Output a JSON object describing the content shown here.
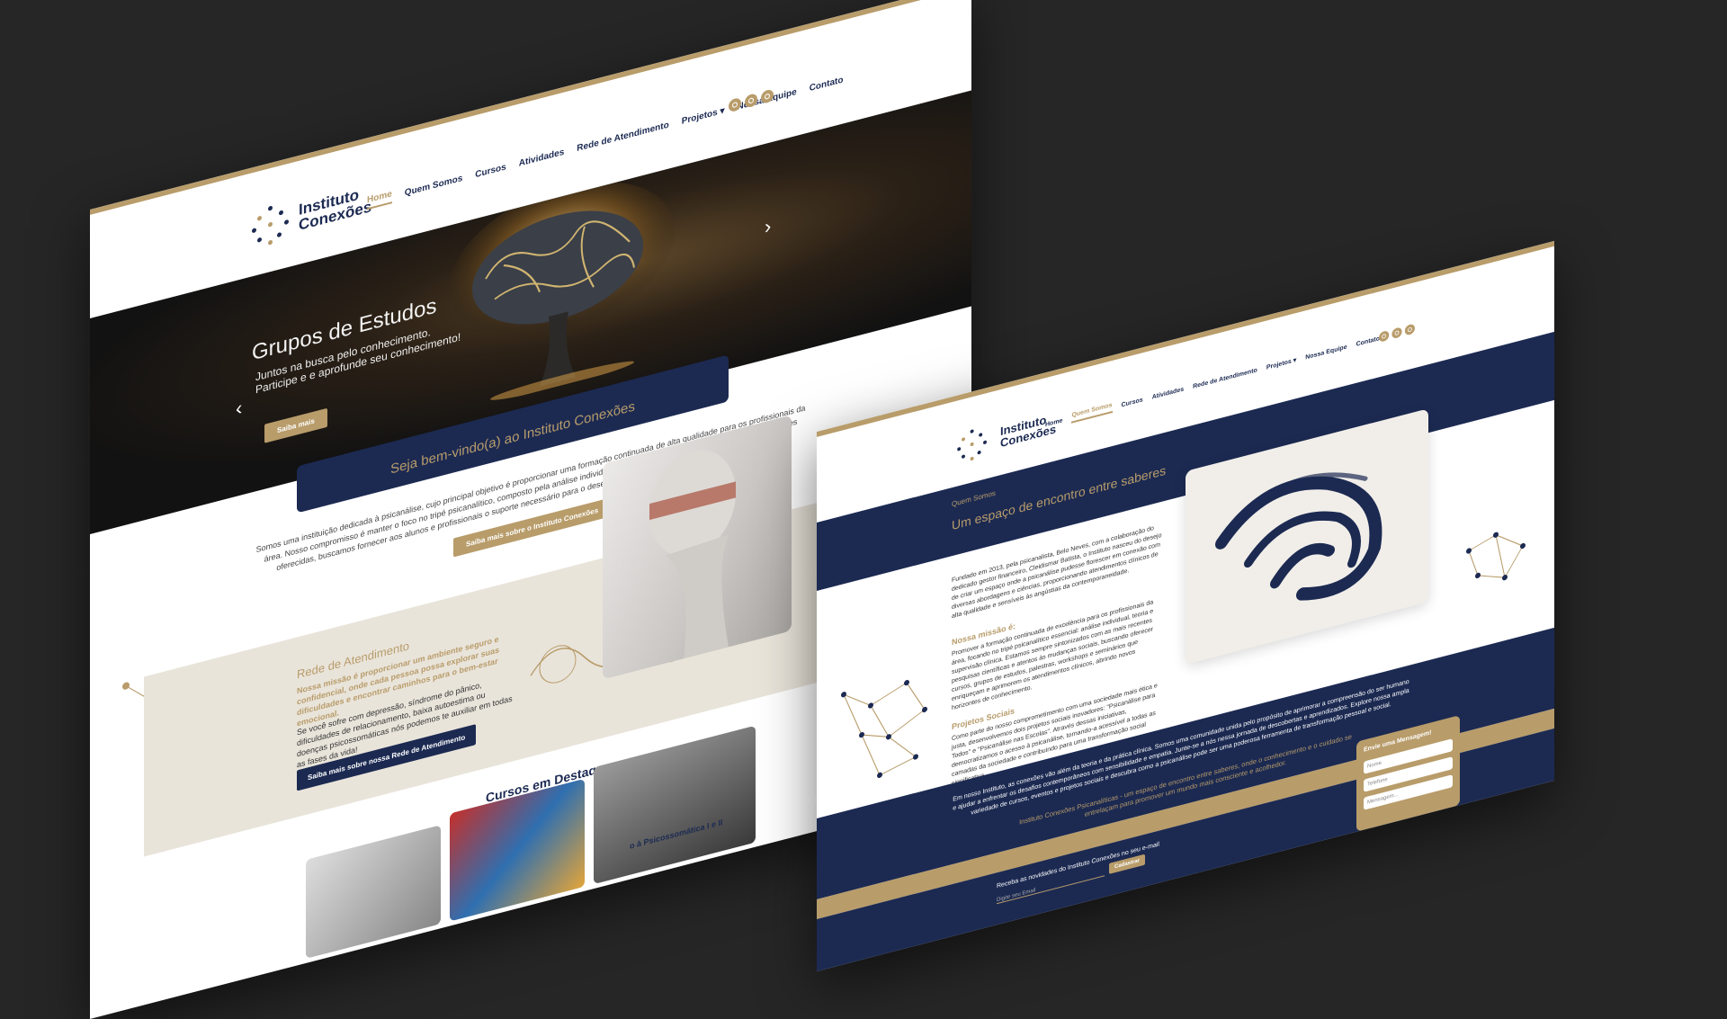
{
  "colors": {
    "navy": "#1c2a52",
    "gold": "#b89c6a",
    "bg": "#262626",
    "beige": "#e9e4da"
  },
  "brand": {
    "line1": "Instituto",
    "line2": "Conexões"
  },
  "nav": {
    "items": [
      "Home",
      "Quem Somos",
      "Cursos",
      "Atividades",
      "Rede de Atendimento",
      "Projetos",
      "Nossa Equipe",
      "Contato"
    ],
    "dropdown_icon": "chevron-down-icon"
  },
  "social": [
    "facebook-icon",
    "instagram-icon",
    "whatsapp-icon"
  ],
  "page1": {
    "hero": {
      "title": "Grupos de Estudos",
      "line1": "Juntos na busca pelo conhecimento.",
      "line2": "Participe e e aprofunde seu conhecimento!",
      "button": "Saiba mais"
    },
    "welcome": "Seja bem-vindo(a) ao Instituto Conexões",
    "intro": {
      "l1": "Somos uma instituição dedicada à psicanálise, cujo principal objetivo é proporcionar uma formação continuada de alta qualidade para os profissionais da",
      "l2": "área. Nosso compromisso é manter o foco no tripé psicanalítico, composto pela análise individual, teoria e supervisão clínica. Através das atividades",
      "l3": "oferecidas, buscamos fornecer aos alunos e profissionais o suporte necessário para o desenvolvimento de uma prática clínica sólida e eficaz.",
      "button": "Saiba mais sobre o Instituto Conexões"
    },
    "rede": {
      "title": "Rede de Atendimento",
      "mission": "Nossa missão é proporcionar um ambiente seguro e confidencial, onde cada pessoa possa explorar suas dificuldades e encontrar caminhos para o bem-estar emocional.",
      "text": "Se você sofre com depressão, síndrome do pânico, dificuldades de relacionamento, baixa autoestima ou doenças psicossomáticas nós podemos te auxiliar em todas as fases da vida!",
      "button": "Saiba mais sobre nossa Rede de Atendimento"
    },
    "cursos": {
      "title": "Cursos em Destaque",
      "partial": "o à Psicossomática I e II"
    }
  },
  "page2": {
    "breadcrumb": "Quem Somos",
    "title": "Um espaço de encontro entre saberes",
    "p1": "Fundado em 2013, pela psicanalista, Belo Neves, com a colaboração do dedicado gestor financeiro, Cleidismar Batista, o Instituto nasceu do desejo de criar um espaço onde a psicanálise pudesse florescer em conexão com diversas abordagens e ciências, proporcionando atendimentos clínicos de alta qualidade e sensíveis às angústias da contemporaneidade.",
    "missao_title": "Nossa missão é:",
    "missao": "Promover a formação continuada de excelência para os profissionais da área, focando no tripé psicanalítico essencial: análise individual, teoria e supervisão clínica. Estamos sempre sintonizados com as mais recentes pesquisas científicas e atentos às mudanças sociais, buscando oferecer cursos, grupos de estudos, palestras, workshops e seminários que enriqueçam e aprimorem os atendimentos clínicos, abrindo novos horizontes de conhecimento.",
    "projetos_title": "Projetos Sociais",
    "projetos": "Como parte do nosso comprometimento com uma sociedade mais ética e justa, desenvolvemos dois projetos sociais inovadores: \"Psicanálise para Todos\" e \"Psicanálise nas Escolas\". Através dessas iniciativas, democratizamos o acesso à psicanálise, tornando-a acessível a todas as camadas da sociedade e contribuindo para uma transformação social significativa.",
    "footer_text": "Em nosso Instituto, as conexões vão além da teoria e da prática clínica. Somos uma comunidade unida pelo propósito de aprimorar a compreensão do ser humano e ajudar a enfrentar os desafios contemporâneos com sensibilidade e empatia. Junte-se a nós nessa jornada de descobertas e aprendizados. Explore nossa ampla variedade de cursos, eventos e projetos sociais e descubra como a psicanálise pode ser uma poderosa ferramenta de transformação pessoal e social.",
    "footer_gold": "Instituto Conexões Psicanalíticas - um espaço de encontro entre saberes, onde o conhecimento e o cuidado se entrelaçam para promover um mundo mais consciente e acolhedor.",
    "newsletter": {
      "label": "Receba as novidades do Instituto Conexões no seu e-mail",
      "placeholder": "Digite seu Email",
      "button": "Cadastrar"
    },
    "form": {
      "title": "Envie uma Mensagem!",
      "name": "Nome",
      "phone": "Telefone",
      "message": "Mensagem..."
    }
  }
}
